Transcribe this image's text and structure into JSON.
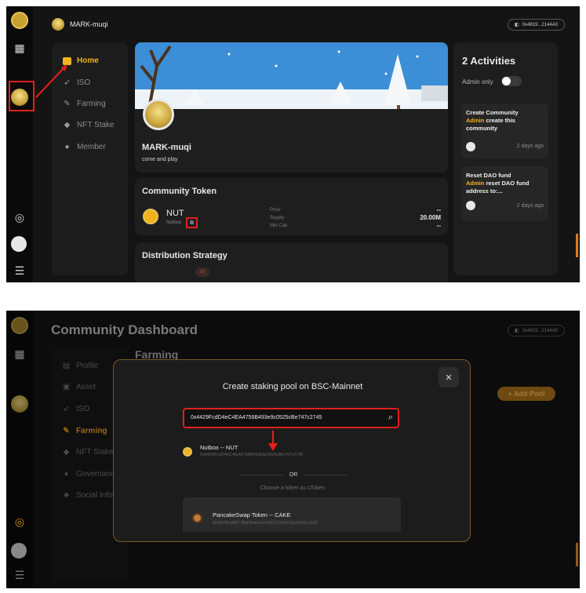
{
  "top": {
    "username": "MARK-muqi",
    "address": "0x4819...2144A0",
    "nav": [
      {
        "label": "Home",
        "icon": "home-icon",
        "active": true
      },
      {
        "label": "ISO",
        "icon": "rocket-icon"
      },
      {
        "label": "Farming",
        "icon": "farming-icon"
      },
      {
        "label": "NFT Stake",
        "icon": "nft-icon"
      },
      {
        "label": "Member",
        "icon": "member-icon"
      }
    ],
    "profile": {
      "name": "MARK-muqi",
      "tagline": "come and play"
    },
    "community_token": {
      "heading": "Community Token",
      "symbol": "NUT",
      "name": "Nutbox",
      "stats": [
        {
          "label": "Price",
          "value": "--"
        },
        {
          "label": "Supply",
          "value": "20.00M"
        },
        {
          "label": "Mkt Cap",
          "value": "--"
        }
      ]
    },
    "distribution": {
      "heading": "Distribution Strategy",
      "marker": "10"
    },
    "activities": {
      "title": "2 Activities",
      "admin_only": "Admin only",
      "items": [
        {
          "title": "Create Community",
          "actor": "Admin",
          "desc1": "create this",
          "desc2": "community",
          "time": "2 days ago"
        },
        {
          "title": "Reset DAO fund",
          "actor": "Admin",
          "desc1": "reset DAO fund",
          "desc2": "address to:...",
          "time": "2 days ago"
        }
      ]
    }
  },
  "bottom": {
    "title": "Community Dashboard",
    "address": "0x4819...2144A0",
    "section": "Farming",
    "add_pool": "+ Add Pool",
    "nav": [
      {
        "label": "Profile",
        "icon": "profile-icon"
      },
      {
        "label": "Asset",
        "icon": "asset-icon"
      },
      {
        "label": "ISO",
        "icon": "rocket-icon"
      },
      {
        "label": "Farming",
        "icon": "farming-icon",
        "active": true
      },
      {
        "label": "NFT Stake",
        "icon": "nft-icon"
      },
      {
        "label": "Governance",
        "icon": "governance-icon"
      },
      {
        "label": "Social Info",
        "icon": "social-icon"
      }
    ],
    "modal": {
      "title": "Create staking pool on BSC-Mainnet",
      "search_value": "0x4429FcdD4eC4EA4756B493e9c0525cBe747c2745",
      "result_title": "Nutbox -- NUT",
      "result_address": "0x4429FcdD4eC4EA4756B493e9c0525cBe747c2745",
      "or": "OR",
      "choose": "Choose a token as cToken",
      "option_title": "PancakeSwap Token -- CAKE",
      "option_address": "0x0E09FaBB73Bd3Ade0a17ECC321fD13a19e81cE82"
    }
  }
}
